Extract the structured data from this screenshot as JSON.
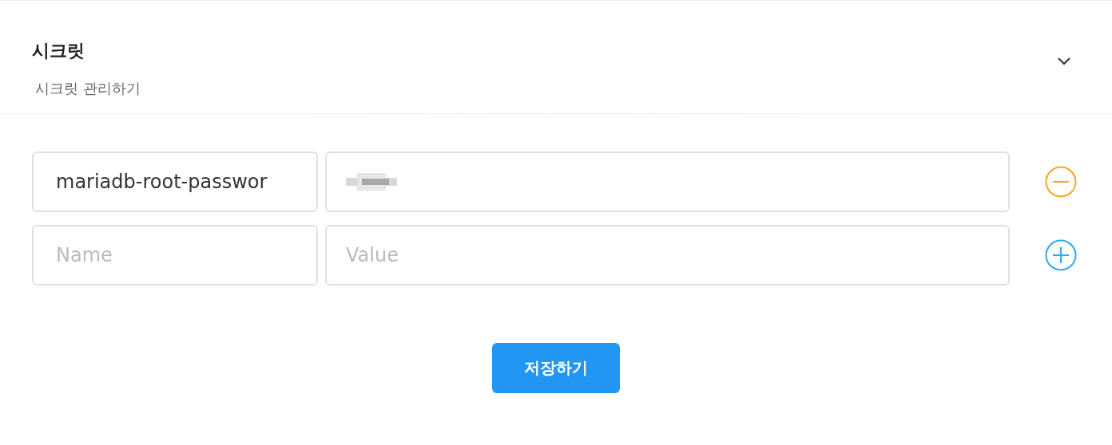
{
  "section": {
    "title": "시크릿",
    "subtitle": "시크릿 관리하기",
    "expanded": true
  },
  "rows": [
    {
      "name": {
        "value": "mariadb-root-passwor"
      },
      "value": {
        "masked": true
      },
      "kind": "remove"
    },
    {
      "name": {
        "placeholder": "Name"
      },
      "value": {
        "placeholder": "Value"
      },
      "kind": "add"
    }
  ],
  "save_button": "저장하기"
}
